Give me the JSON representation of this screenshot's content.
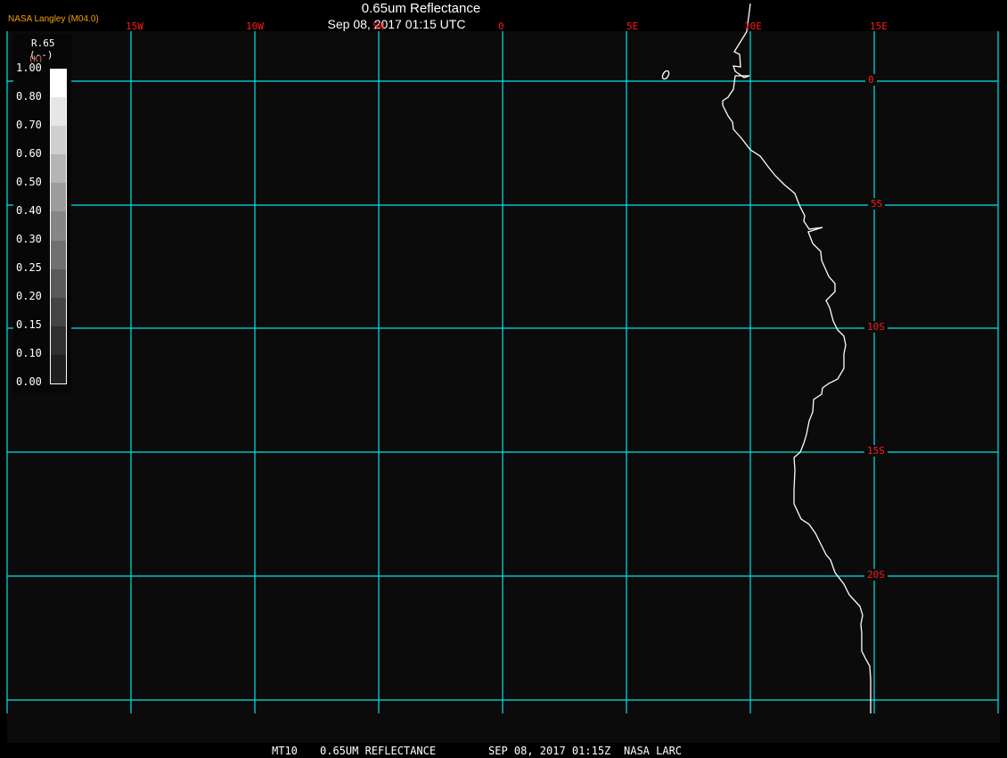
{
  "header": {
    "credit": "NASA Langley (M04.0)",
    "title": "0.65um Reflectance",
    "subtitle": "Sep 08, 2017 01:15 UTC"
  },
  "map": {
    "background": "#0b0b0b",
    "grid_color": "#00e5e5",
    "coast_color": "#ffffff",
    "label_color": "#ff1a1a",
    "lon_labels": [
      "15W",
      "10W",
      "5W",
      "0",
      "5E",
      "10E",
      "15E"
    ],
    "lat_labels": [
      "0",
      "5S",
      "10S",
      "15S",
      "20S"
    ]
  },
  "legend": {
    "variable": "R.65",
    "units": "(--)",
    "units_alt": "(K)",
    "ticks": [
      "1.00",
      "0.80",
      "0.70",
      "0.60",
      "0.50",
      "0.40",
      "0.30",
      "0.25",
      "0.20",
      "0.15",
      "0.10",
      "0.00"
    ],
    "colors": [
      "#ffffff",
      "#e6e6e6",
      "#cfcfcf",
      "#b5b5b5",
      "#9c9c9c",
      "#868686",
      "#707070",
      "#5a5a5a",
      "#444444",
      "#2f2f2f",
      "#202020"
    ]
  },
  "footer": {
    "product": "MT10",
    "channel": "0.65UM REFLECTANCE",
    "datetime": "SEP 08, 2017 01:15Z",
    "source": "NASA LARC"
  }
}
